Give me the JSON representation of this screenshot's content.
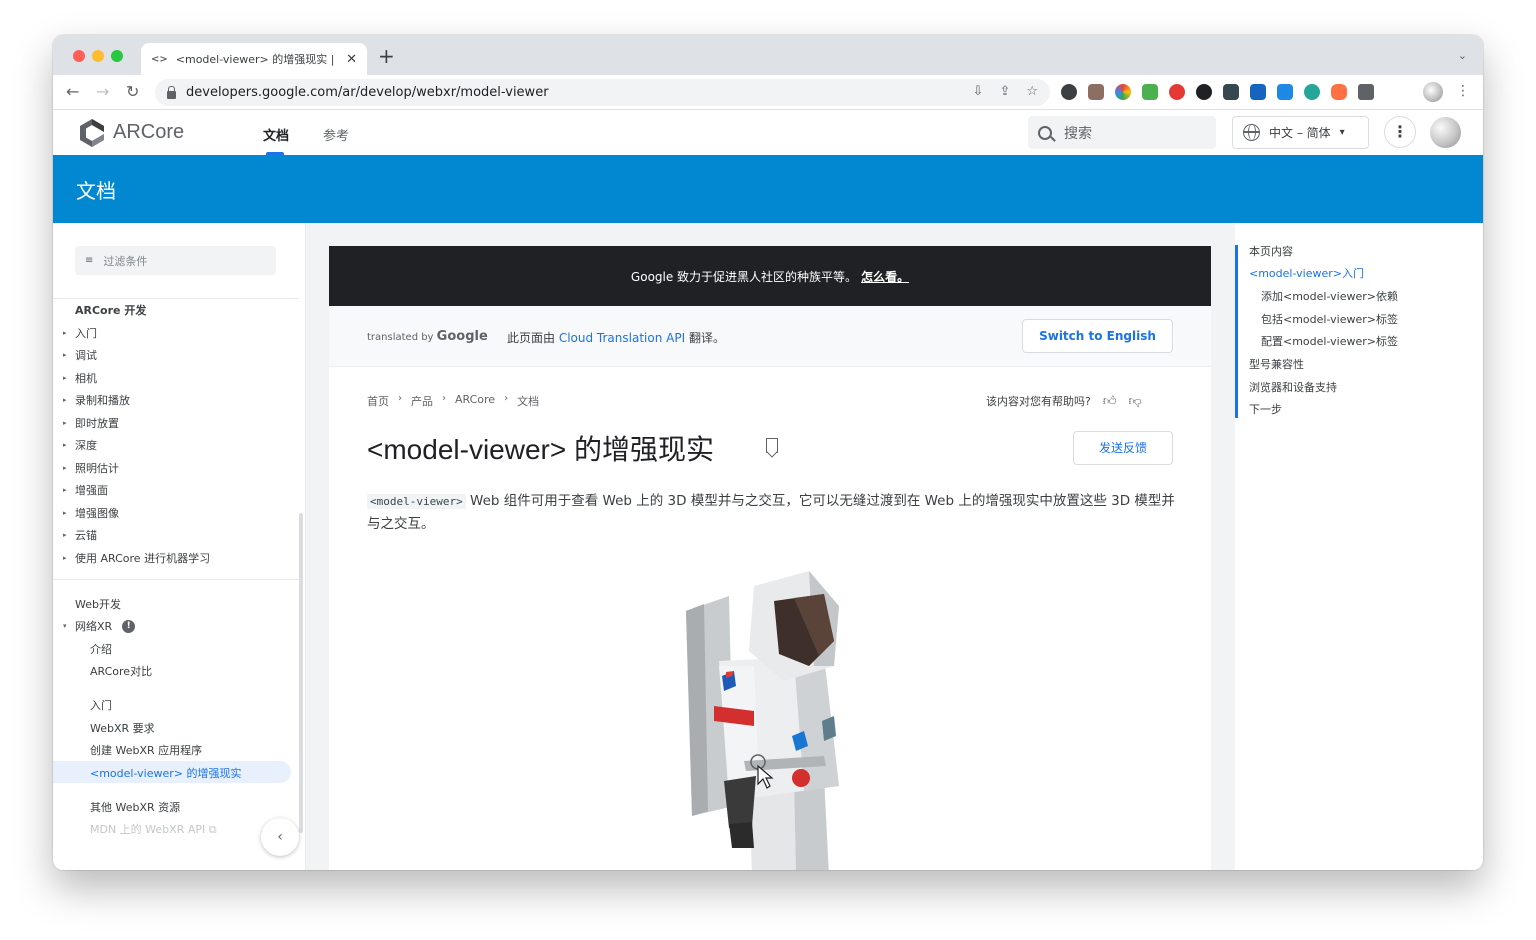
{
  "browser": {
    "tab_title": "<model-viewer> 的增强现实 |",
    "tab_favicon": "<>",
    "url": "developers.google.com/ar/develop/webxr/model-viewer"
  },
  "site": {
    "logo_text": "ARCore",
    "nav_docs": "文档",
    "nav_reference": "参考",
    "search_placeholder": "搜索",
    "language": "中文 – 简体",
    "language_caret": "▾"
  },
  "banner": {
    "title": "文档"
  },
  "sidebar": {
    "filter_placeholder": "过滤条件",
    "section1_heading": "ARCore 开发",
    "section1_items": [
      "入门",
      "调试",
      "相机",
      "录制和播放",
      "即时放置",
      "深度",
      "照明估计",
      "增强面",
      "增强图像",
      "云锚",
      "使用 ARCore 进行机器学习"
    ],
    "section2_heading": "Web开发",
    "webxr_label": "网络XR",
    "webxr_badge": "!",
    "webxr_sub": [
      "介绍",
      "ARCore对比"
    ],
    "getting_started": [
      "入门",
      "WebXR 要求",
      "创建 WebXR 应用程序"
    ],
    "active_item": "<model-viewer> 的增强现实",
    "other_resources": "其他 WebXR 资源",
    "mdn_link": "MDN 上的 WebXR API"
  },
  "article": {
    "notice_text": "Google 致力于促进黑人社区的种族平等。",
    "notice_link": "怎么看。",
    "translated_by": "translated by",
    "google": "Google",
    "translation_msg_prefix": "此页面由",
    "translation_link": "Cloud Translation API",
    "translation_msg_suffix": "翻译。",
    "switch_label": "Switch to English",
    "breadcrumbs": [
      "首页",
      "产品",
      "ARCore",
      "文档"
    ],
    "helpful_question": "该内容对您有帮助吗?",
    "title": "<model-viewer> 的增强现实",
    "feedback_label": "发送反馈",
    "intro_code": "<model-viewer>",
    "intro_text": " Web 组件可用于查看 Web 上的 3D 模型并与之交互，它可以无缝过渡到在 Web 上的增强现实中放置这些 3D 模型并与之交互。"
  },
  "toc": {
    "title": "本页内容",
    "items": [
      "<model-viewer>入门",
      "添加<model-viewer>依赖",
      "包括<model-viewer>标签",
      "配置<model-viewer>标签",
      "型号兼容性",
      "浏览器和设备支持",
      "下一步"
    ]
  },
  "colors": {
    "accent": "#1a73e8",
    "banner": "#0288d1",
    "notice": "#202124"
  }
}
